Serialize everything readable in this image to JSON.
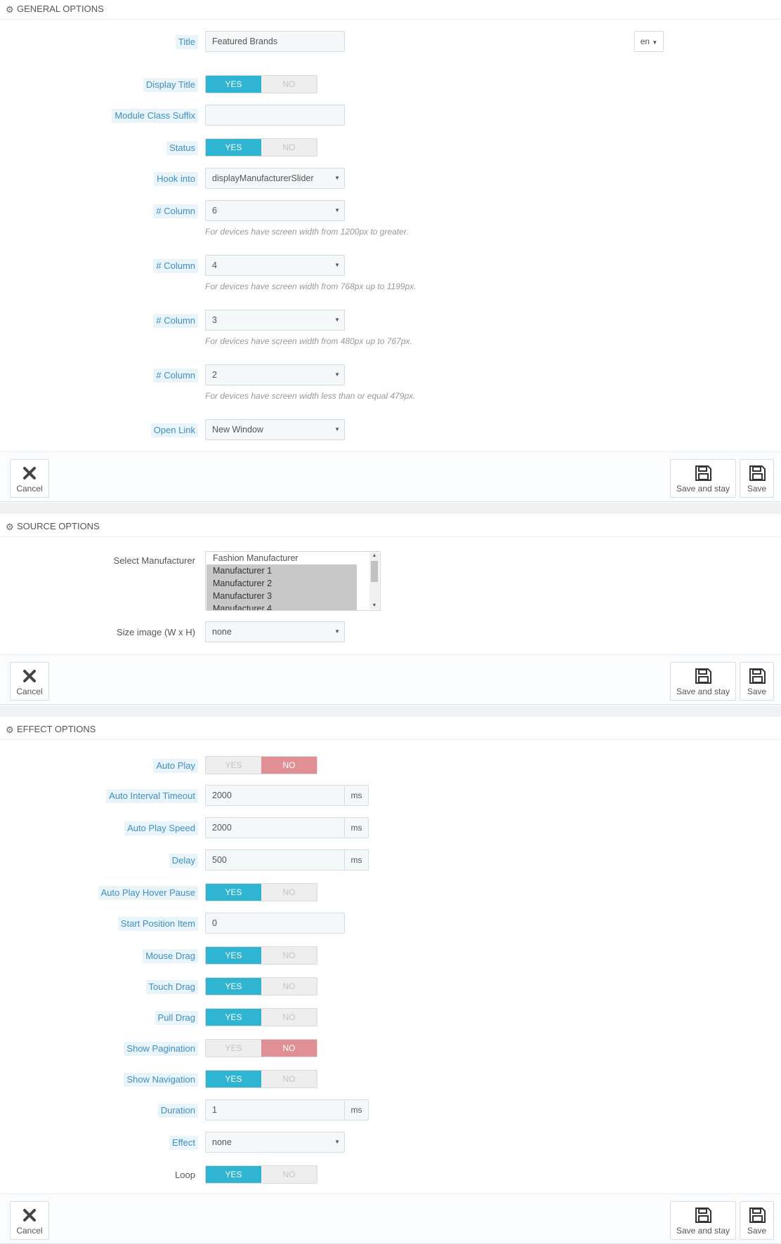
{
  "general": {
    "heading": "GENERAL OPTIONS",
    "title_label": "Title",
    "title_value": "Featured Brands",
    "lang": "en",
    "display_title_label": "Display Title",
    "module_class_suffix_label": "Module Class Suffix",
    "module_class_suffix_value": "",
    "status_label": "Status",
    "hook_into_label": "Hook into",
    "hook_into_value": "displayManufacturerSlider",
    "columns": [
      {
        "label": "# Column",
        "value": "6",
        "help": "For devices have screen width from 1200px to greater."
      },
      {
        "label": "# Column",
        "value": "4",
        "help": "For devices have screen width from 768px up to 1199px."
      },
      {
        "label": "# Column",
        "value": "3",
        "help": "For devices have screen width from 480px up to 767px."
      },
      {
        "label": "# Column",
        "value": "2",
        "help": "For devices have screen width less than or equal 479px."
      }
    ],
    "open_link_label": "Open Link",
    "open_link_value": "New Window"
  },
  "source": {
    "heading": "SOURCE OPTIONS",
    "select_manufacturer_label": "Select Manufacturer",
    "manufacturers": [
      {
        "name": "Fashion Manufacturer",
        "selected": false
      },
      {
        "name": "Manufacturer 1",
        "selected": true
      },
      {
        "name": "Manufacturer 2",
        "selected": true
      },
      {
        "name": "Manufacturer 3",
        "selected": true
      },
      {
        "name": "Manufacturer 4",
        "selected": true
      }
    ],
    "size_image_label": "Size image (W x H)",
    "size_image_value": "none"
  },
  "effect": {
    "heading": "EFFECT OPTIONS",
    "auto_play_label": "Auto Play",
    "auto_interval_timeout_label": "Auto Interval Timeout",
    "auto_interval_timeout_value": "2000",
    "auto_play_speed_label": "Auto Play Speed",
    "auto_play_speed_value": "2000",
    "delay_label": "Delay",
    "delay_value": "500",
    "auto_play_hover_pause_label": "Auto Play Hover Pause",
    "start_position_item_label": "Start Position Item",
    "start_position_item_value": "0",
    "mouse_drag_label": "Mouse Drag",
    "touch_drag_label": "Touch Drag",
    "pull_drag_label": "Pull Drag",
    "show_pagination_label": "Show Pagination",
    "show_navigation_label": "Show Navigation",
    "duration_label": "Duration",
    "duration_value": "1",
    "effect_label": "Effect",
    "effect_value": "none",
    "loop_label": "Loop",
    "unit": "ms"
  },
  "switch": {
    "yes": "YES",
    "no": "NO"
  },
  "toggles": {
    "display_title": "yes",
    "status": "yes",
    "auto_play": "no",
    "auto_play_hover_pause": "yes",
    "mouse_drag": "yes",
    "touch_drag": "yes",
    "pull_drag": "yes",
    "show_pagination": "no",
    "show_navigation": "yes",
    "loop": "yes"
  },
  "buttons": {
    "cancel": "Cancel",
    "save_and_stay": "Save and stay",
    "save": "Save"
  },
  "colors": {
    "accent": "#2fb5d2",
    "no_active": "#e08f95",
    "label_hint": "#3f8fc4"
  }
}
